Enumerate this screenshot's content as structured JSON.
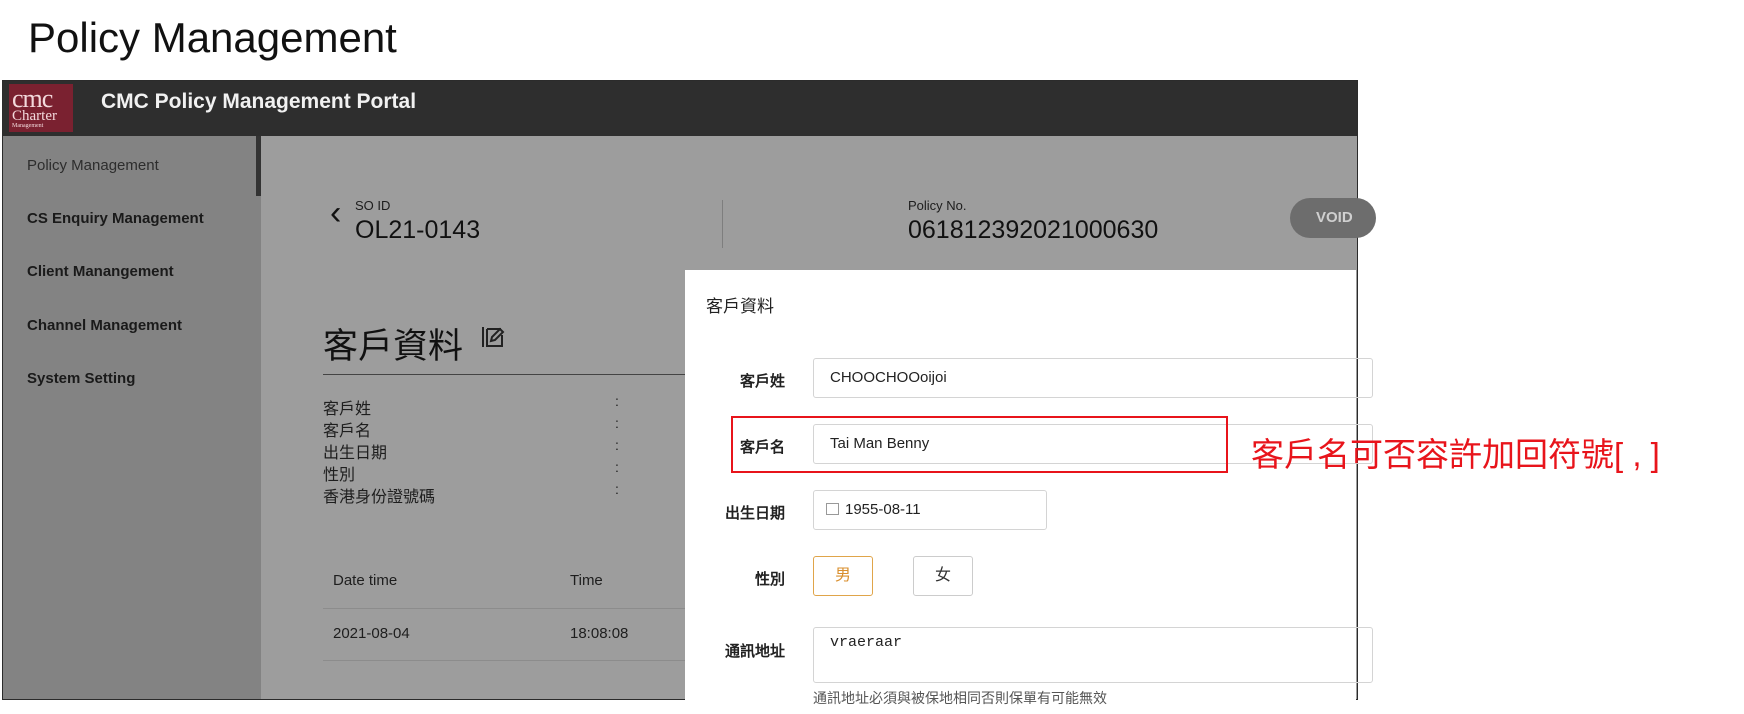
{
  "doc_title": "Policy Management",
  "app": {
    "logo_line1": "cmc",
    "logo_line2": "Charter",
    "logo_line3": "Management",
    "title": "CMC Policy Management Portal"
  },
  "sidebar": {
    "items": [
      {
        "label": "Policy Management"
      },
      {
        "label": "CS Enquiry Management"
      },
      {
        "label": "Client Manangement"
      },
      {
        "label": "Channel Management"
      },
      {
        "label": "System Setting"
      }
    ]
  },
  "header": {
    "so_id_label": "SO ID",
    "so_id": "OL21-0143",
    "policy_no_label": "Policy No.",
    "policy_no": "061812392021000630",
    "void_button": "VOID"
  },
  "client_section": {
    "title": "客戶資料",
    "fields": [
      {
        "label": "客戶姓",
        "sep": ":"
      },
      {
        "label": "客戶名",
        "sep": ":"
      },
      {
        "label": "出生日期",
        "sep": ":"
      },
      {
        "label": "性別",
        "sep": ":"
      },
      {
        "label": "香港身份證號碼",
        "sep": ":"
      }
    ]
  },
  "history_table": {
    "columns": [
      "Date time",
      "Time"
    ],
    "rows": [
      [
        "2021-08-04",
        "18:08:08"
      ]
    ]
  },
  "modal": {
    "title": "客戶資料",
    "surname_label": "客戶姓",
    "surname_value": "CHOOCHOOoijoi",
    "given_name_label": "客戶名",
    "given_name_value": "Tai Man Benny",
    "dob_label": "出生日期",
    "dob_value": "1955-08-11",
    "gender_label": "性別",
    "gender_male": "男",
    "gender_female": "女",
    "gender_selected": "男",
    "address_label": "通訊地址",
    "address_value": "vraeraar",
    "address_hint": "通訊地址必須與被保地相同否則保單有可能無效"
  },
  "annotation": {
    "text": "客戶名可否容許加回符號[ , ]",
    "color": "#e8141b"
  },
  "colors": {
    "topbar": "#2e2e2e",
    "logo_bg": "#7a2130",
    "gender_selected": "#d98f2e"
  }
}
